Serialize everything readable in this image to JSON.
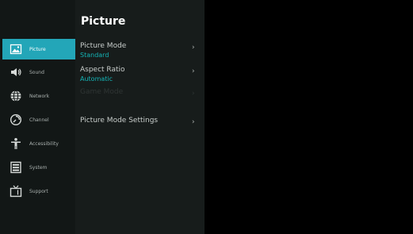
{
  "panel": {
    "title": "Picture",
    "rows": [
      {
        "label": "Picture Mode",
        "value": "Standard",
        "chevron": "›"
      },
      {
        "label": "Aspect Ratio",
        "value": "Automatic",
        "chevron": "›"
      },
      {
        "label": "Game Mode",
        "value": "",
        "chevron": "›"
      },
      {
        "label": "Picture Mode Settings",
        "value": "",
        "chevron": "›"
      }
    ]
  },
  "sidebar": {
    "items": [
      {
        "label": "Picture",
        "icon": "picture-icon",
        "active": true
      },
      {
        "label": "Sound",
        "icon": "speaker-icon",
        "active": false
      },
      {
        "label": "Network",
        "icon": "globe-icon",
        "active": false
      },
      {
        "label": "Channel",
        "icon": "channel-icon",
        "active": false
      },
      {
        "label": "Accessibility",
        "icon": "accessibility-icon",
        "active": false
      },
      {
        "label": "System",
        "icon": "system-icon",
        "active": false
      },
      {
        "label": "Support",
        "icon": "tv-icon",
        "active": false
      }
    ]
  },
  "colors": {
    "accent": "#23a6b8",
    "value_text": "#14b4b6",
    "sidebar_bg": "#121716",
    "panel_bg": "#171c1b"
  }
}
